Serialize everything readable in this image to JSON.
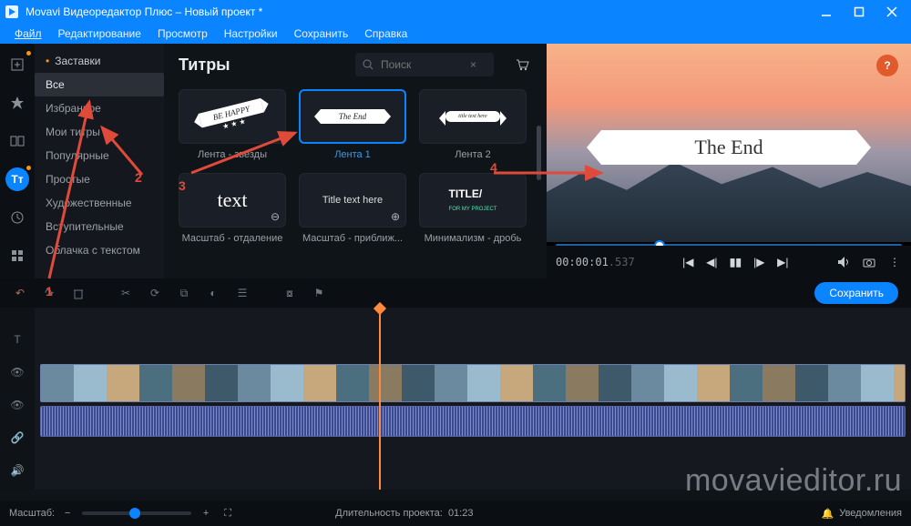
{
  "window": {
    "title": "Movavi Видеоредактор Плюс – Новый проект *",
    "help_badge": "?"
  },
  "menubar": [
    "Файл",
    "Редактирование",
    "Просмотр",
    "Настройки",
    "Сохранить",
    "Справка"
  ],
  "left_rail_icons": [
    "add",
    "sparkle",
    "transition",
    "titles",
    "clock",
    "grid"
  ],
  "sidebar": {
    "header": "Заставки",
    "items": [
      "Все",
      "Избранное",
      "Мои титры",
      "Популярные",
      "Простые",
      "Художественные",
      "Вступительные",
      "Облачка с текстом"
    ],
    "selected_index": 0
  },
  "content": {
    "title": "Титры",
    "search_placeholder": "Поиск",
    "tiles": [
      {
        "label": "Лента - звезды",
        "thumb_text": "BE HAPPY",
        "selected": false
      },
      {
        "label": "Лента 1",
        "thumb_text": "The End",
        "selected": true
      },
      {
        "label": "Лента 2",
        "thumb_text": "title text here",
        "selected": false
      },
      {
        "label": "Масштаб - отдаление",
        "thumb_text": "text",
        "selected": false,
        "zoom": "out"
      },
      {
        "label": "Масштаб - приближ...",
        "thumb_text": "Title text here",
        "selected": false,
        "zoom": "in"
      },
      {
        "label": "Минимализм - дробь",
        "thumb_text": "TITLE/",
        "thumb_sub": "FOR MY PROJECT",
        "selected": false
      }
    ]
  },
  "preview": {
    "ribbon_text": "The End",
    "timecode": "00:00:01",
    "timecode_ms": ".537",
    "controls": [
      "skip-start",
      "step-back",
      "pause",
      "step-fwd",
      "skip-end"
    ],
    "right_controls": [
      "volume",
      "camera",
      "more"
    ]
  },
  "tl_toolbar": {
    "undo_group": [
      "undo",
      "redo",
      "trash"
    ],
    "edit_group": [
      "cut",
      "rotate",
      "crop",
      "color",
      "adjust"
    ],
    "misc_group": [
      "overlay",
      "marker"
    ],
    "save_label": "Сохранить"
  },
  "timeline": {
    "row1_label": "T",
    "row2_label": "video",
    "row3_label": "audio"
  },
  "footer": {
    "zoom_label": "Масштаб:",
    "duration_label": "Длительность проекта:",
    "duration_value": "01:23",
    "notifications": "Уведомления"
  },
  "watermark": "movavieditor.ru",
  "annotations": {
    "n1": "1",
    "n2": "2",
    "n3": "3",
    "n4": "4"
  }
}
